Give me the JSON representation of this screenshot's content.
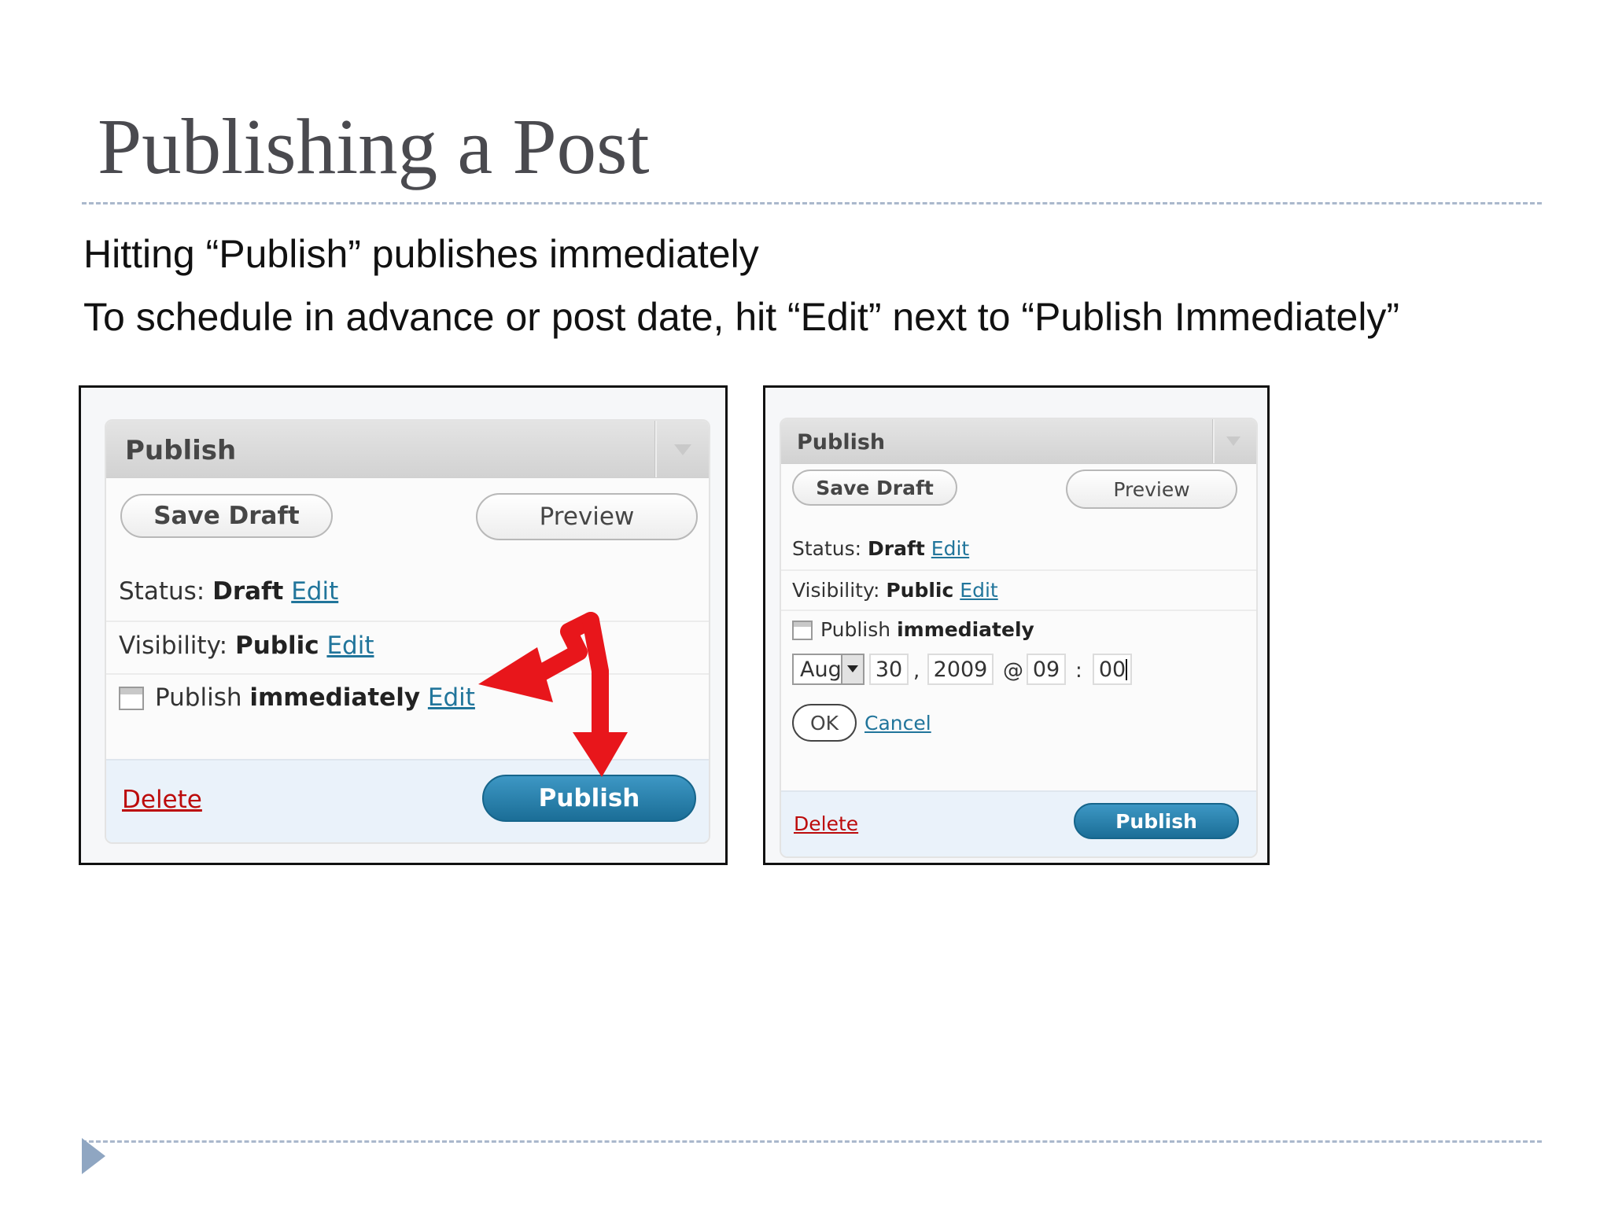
{
  "slide": {
    "title": "Publishing a Post",
    "bullets": [
      "Hitting “Publish” publishes immediately",
      "To schedule in advance or post date, hit “Edit” next to “Publish Immediately”"
    ]
  },
  "left_panel": {
    "title": "Publish",
    "save_draft": "Save Draft",
    "preview": "Preview",
    "status_label": "Status:",
    "status_value": "Draft",
    "status_edit": "Edit",
    "visibility_label": "Visibility:",
    "visibility_value": "Public",
    "visibility_edit": "Edit",
    "publish_label": "Publish",
    "publish_value": "immediately",
    "publish_edit": "Edit",
    "delete": "Delete",
    "publish_button": "Publish"
  },
  "right_panel": {
    "title": "Publish",
    "save_draft": "Save Draft",
    "preview": "Preview",
    "status_label": "Status:",
    "status_value": "Draft",
    "status_edit": "Edit",
    "visibility_label": "Visibility:",
    "visibility_value": "Public",
    "visibility_edit": "Edit",
    "publish_label": "Publish",
    "publish_value": "immediately",
    "date": {
      "month": "Aug",
      "day": "30",
      "comma": ",",
      "year": "2009",
      "at": "@",
      "hour": "09",
      "colon": ":",
      "minute": "00"
    },
    "ok": "OK",
    "cancel": "Cancel",
    "delete": "Delete",
    "publish_button": "Publish"
  },
  "colors": {
    "link": "#21759b",
    "delete": "#bc0b0b",
    "publish_button": "#21759b",
    "arrow": "#e8161b"
  }
}
